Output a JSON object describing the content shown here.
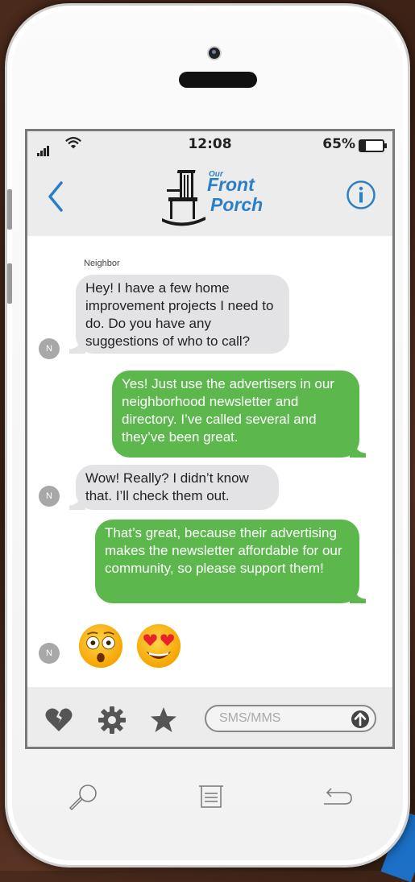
{
  "status_bar": {
    "time": "12:08",
    "battery": "65%",
    "signal_icon": "signal-bars-icon",
    "wifi_icon": "wifi-icon"
  },
  "nav": {
    "back_icon": "chevron-left-icon",
    "info_icon": "info-icon",
    "logo": {
      "small": "Our",
      "line1": "Front",
      "line2": "Porch",
      "icon": "rocking-chair-icon"
    }
  },
  "conversation": {
    "sender_name": "Neighbor",
    "avatar_initial": "N",
    "messages": [
      {
        "direction": "in",
        "text": "Hey! I have a few home improvement projects I need to do. Do you have any suggestions of who to call?"
      },
      {
        "direction": "out",
        "text": "Yes! Just use the advertisers in our neighborhood newsletter and directory. I’ve called several and they’ve been great."
      },
      {
        "direction": "in",
        "text": "Wow! Really? I didn’t know that. I’ll check them out."
      },
      {
        "direction": "out",
        "text": "That’s great, because their advertising makes the newsletter affordable for our community, so please support them!"
      },
      {
        "direction": "in",
        "emojis": [
          "flushed-face-emoji",
          "heart-eyes-emoji"
        ]
      }
    ]
  },
  "toolbar": {
    "icons": [
      "heart-icon",
      "gear-icon",
      "star-icon"
    ],
    "input_placeholder": "SMS/MMS",
    "send_icon": "arrow-up-circle-icon"
  },
  "phone_buttons": {
    "icons": [
      "search-icon",
      "menu-icon",
      "back-arrow-icon"
    ]
  },
  "colors": {
    "accent_blue": "#2b7fc9",
    "outgoing_bubble": "#5cb84d",
    "incoming_bubble": "#e3e3e6"
  }
}
